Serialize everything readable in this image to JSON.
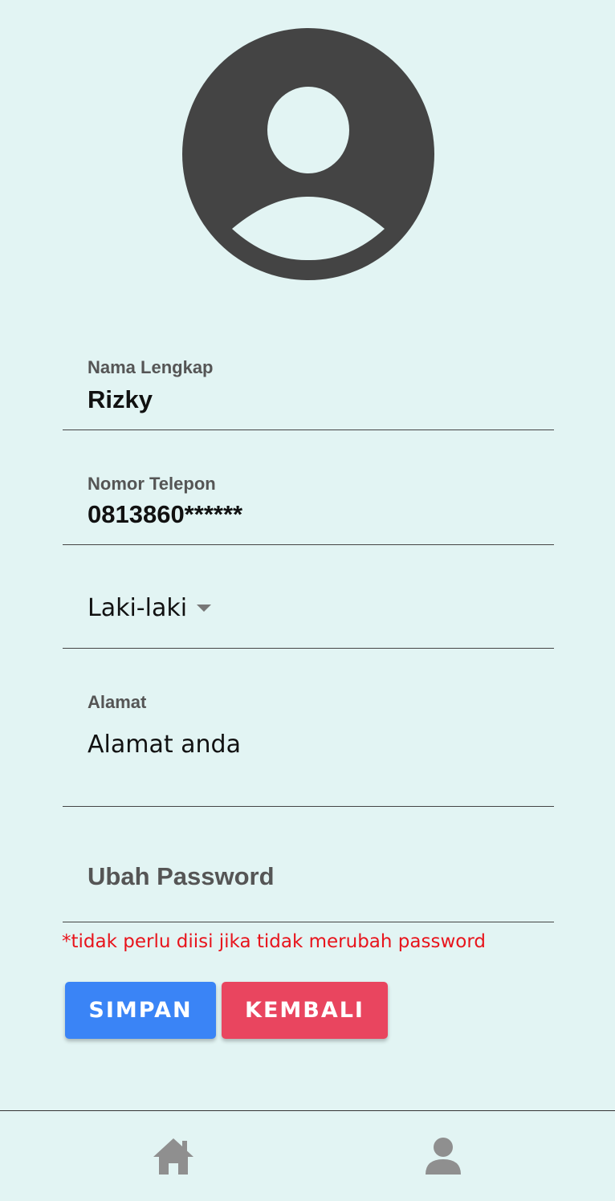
{
  "colors": {
    "background": "#e2f4f3",
    "avatar": "#444444",
    "primary_button": "#3a84f6",
    "danger_button": "#e9455f",
    "hint_text": "#e8141c",
    "nav_icon": "#8f8f8f"
  },
  "profile": {
    "avatar_icon": "user-avatar-icon"
  },
  "form": {
    "nama": {
      "label": "Nama Lengkap",
      "value": "Rizky"
    },
    "telepon": {
      "label": "Nomor Telepon",
      "value": "0813860******"
    },
    "gender": {
      "selected": "Laki-laki"
    },
    "alamat": {
      "label": "Alamat",
      "value": "Alamat anda"
    },
    "password": {
      "placeholder": "Ubah Password",
      "hint": "*tidak perlu diisi jika tidak merubah password"
    }
  },
  "buttons": {
    "save_label": "SIMPAN",
    "back_label": "KEMBALI"
  },
  "nav": {
    "items": [
      {
        "icon": "home-icon"
      },
      {
        "icon": "profile-icon"
      }
    ]
  }
}
